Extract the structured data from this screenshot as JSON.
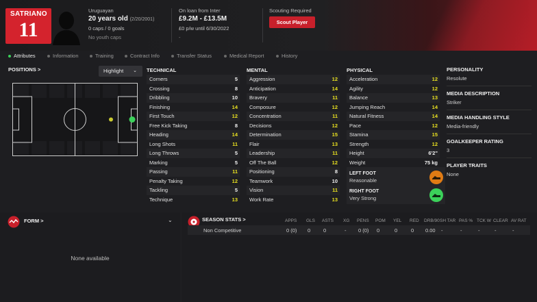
{
  "player": {
    "name": "SATRIANO",
    "number": "11",
    "nationality": "Uruguayan",
    "age": "20 years old",
    "dob": "(2/20/2001)",
    "caps": "0 caps / 0 goals",
    "youth_caps": "No youth caps",
    "loan_status": "On loan from Inter",
    "value": "£9.2M - £13.5M",
    "wage": "£0 p/w until 6/30/2022",
    "wage_extra": "-",
    "scouting_label": "Scouting Required",
    "scout_button": "Scout Player"
  },
  "tabs": [
    "Attributes",
    "Information",
    "Training",
    "Contract Info",
    "Transfer Status",
    "Medical Report",
    "History"
  ],
  "positions_title": "POSITIONS >",
  "highlight_label": "Highlight",
  "technical": {
    "title": "TECHNICAL",
    "rows": [
      {
        "name": "Corners",
        "value": "5",
        "tone": "white"
      },
      {
        "name": "Crossing",
        "value": "8",
        "tone": "white"
      },
      {
        "name": "Dribbling",
        "value": "10",
        "tone": "white"
      },
      {
        "name": "Finishing",
        "value": "14",
        "tone": "yellow"
      },
      {
        "name": "First Touch",
        "value": "12",
        "tone": "yellow"
      },
      {
        "name": "Free Kick Taking",
        "value": "8",
        "tone": "white"
      },
      {
        "name": "Heading",
        "value": "14",
        "tone": "yellow"
      },
      {
        "name": "Long Shots",
        "value": "11",
        "tone": "yellow"
      },
      {
        "name": "Long Throws",
        "value": "5",
        "tone": "white"
      },
      {
        "name": "Marking",
        "value": "5",
        "tone": "white"
      },
      {
        "name": "Passing",
        "value": "11",
        "tone": "yellow"
      },
      {
        "name": "Penalty Taking",
        "value": "12",
        "tone": "yellow"
      },
      {
        "name": "Tackling",
        "value": "5",
        "tone": "white"
      },
      {
        "name": "Technique",
        "value": "13",
        "tone": "yellow"
      }
    ]
  },
  "mental": {
    "title": "MENTAL",
    "rows": [
      {
        "name": "Aggression",
        "value": "12",
        "tone": "yellow"
      },
      {
        "name": "Anticipation",
        "value": "14",
        "tone": "yellow"
      },
      {
        "name": "Bravery",
        "value": "11",
        "tone": "yellow"
      },
      {
        "name": "Composure",
        "value": "12",
        "tone": "yellow"
      },
      {
        "name": "Concentration",
        "value": "11",
        "tone": "yellow"
      },
      {
        "name": "Decisions",
        "value": "12",
        "tone": "yellow"
      },
      {
        "name": "Determination",
        "value": "15",
        "tone": "yellow"
      },
      {
        "name": "Flair",
        "value": "13",
        "tone": "yellow"
      },
      {
        "name": "Leadership",
        "value": "11",
        "tone": "yellow"
      },
      {
        "name": "Off The Ball",
        "value": "12",
        "tone": "yellow"
      },
      {
        "name": "Positioning",
        "value": "8",
        "tone": "white"
      },
      {
        "name": "Teamwork",
        "value": "10",
        "tone": "white"
      },
      {
        "name": "Vision",
        "value": "11",
        "tone": "yellow"
      },
      {
        "name": "Work Rate",
        "value": "13",
        "tone": "yellow"
      }
    ]
  },
  "physical": {
    "title": "PHYSICAL",
    "rows": [
      {
        "name": "Acceleration",
        "value": "12",
        "tone": "yellow"
      },
      {
        "name": "Agility",
        "value": "12",
        "tone": "yellow"
      },
      {
        "name": "Balance",
        "value": "13",
        "tone": "yellow"
      },
      {
        "name": "Jumping Reach",
        "value": "14",
        "tone": "yellow"
      },
      {
        "name": "Natural Fitness",
        "value": "14",
        "tone": "yellow"
      },
      {
        "name": "Pace",
        "value": "12",
        "tone": "yellow"
      },
      {
        "name": "Stamina",
        "value": "15",
        "tone": "yellow"
      },
      {
        "name": "Strength",
        "value": "12",
        "tone": "yellow"
      },
      {
        "name": "Height",
        "value": "6'2\"",
        "tone": "white"
      },
      {
        "name": "Weight",
        "value": "75 kg",
        "tone": "white"
      }
    ],
    "left_foot_title": "LEFT FOOT",
    "left_foot_value": "Reasonable",
    "right_foot_title": "RIGHT FOOT",
    "right_foot_value": "Very Strong"
  },
  "side": {
    "personality_title": "PERSONALITY",
    "personality": "Resolute",
    "media_desc_title": "MEDIA DESCRIPTION",
    "media_desc": "Striker",
    "media_style_title": "MEDIA HANDLING STYLE",
    "media_style": "Media-friendly",
    "gk_title": "GOALKEEPER RATING",
    "gk": "3",
    "traits_title": "PLAYER TRAITS",
    "traits": "None"
  },
  "form": {
    "title": "FORM >",
    "empty": "None available"
  },
  "season": {
    "title": "SEASON STATS >",
    "headers": [
      "APPS",
      "GLS",
      "ASTS",
      "XG",
      "PENS",
      "POM",
      "YEL",
      "RED",
      "DRB/90",
      "SH TAR",
      "PAS %",
      "TCK W",
      "CLEAR",
      "AV RAT"
    ],
    "row_label": "Non Competitive",
    "values": [
      "0 (0)",
      "0",
      "0",
      "-",
      "0 (0)",
      "0",
      "0",
      "0",
      "0.00",
      "-",
      "-",
      "-",
      "-",
      "-"
    ]
  },
  "colors": {
    "accent_red": "#d4232d",
    "yellow": "#e8e020",
    "green": "#3bd15a",
    "orange_boot": "#e07b14"
  }
}
